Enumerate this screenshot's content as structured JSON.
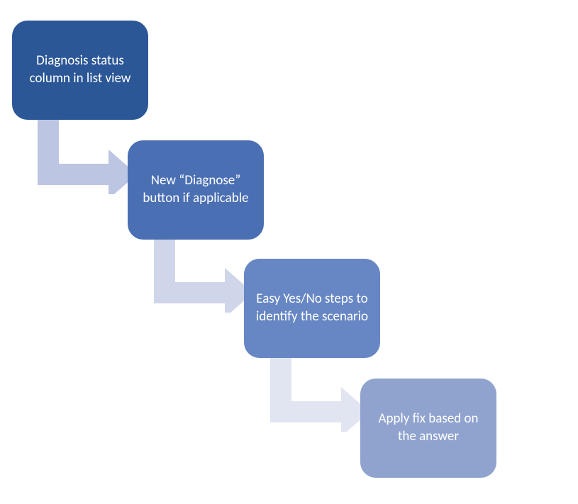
{
  "steps": {
    "s1": "Diagnosis status column in list view",
    "s2": "New “Diagnose” button if applicable",
    "s3": "Easy Yes/No steps to identify the scenario",
    "s4": "Apply fix based on the answer"
  },
  "colors": {
    "box1": "#2b5797",
    "box2": "#4a6fb3",
    "box3": "#6787c4",
    "box4": "#8fa3ce",
    "arr1": "#bcc6e3",
    "arr2": "#cfd6ea",
    "arr3": "#e1e5f2"
  }
}
